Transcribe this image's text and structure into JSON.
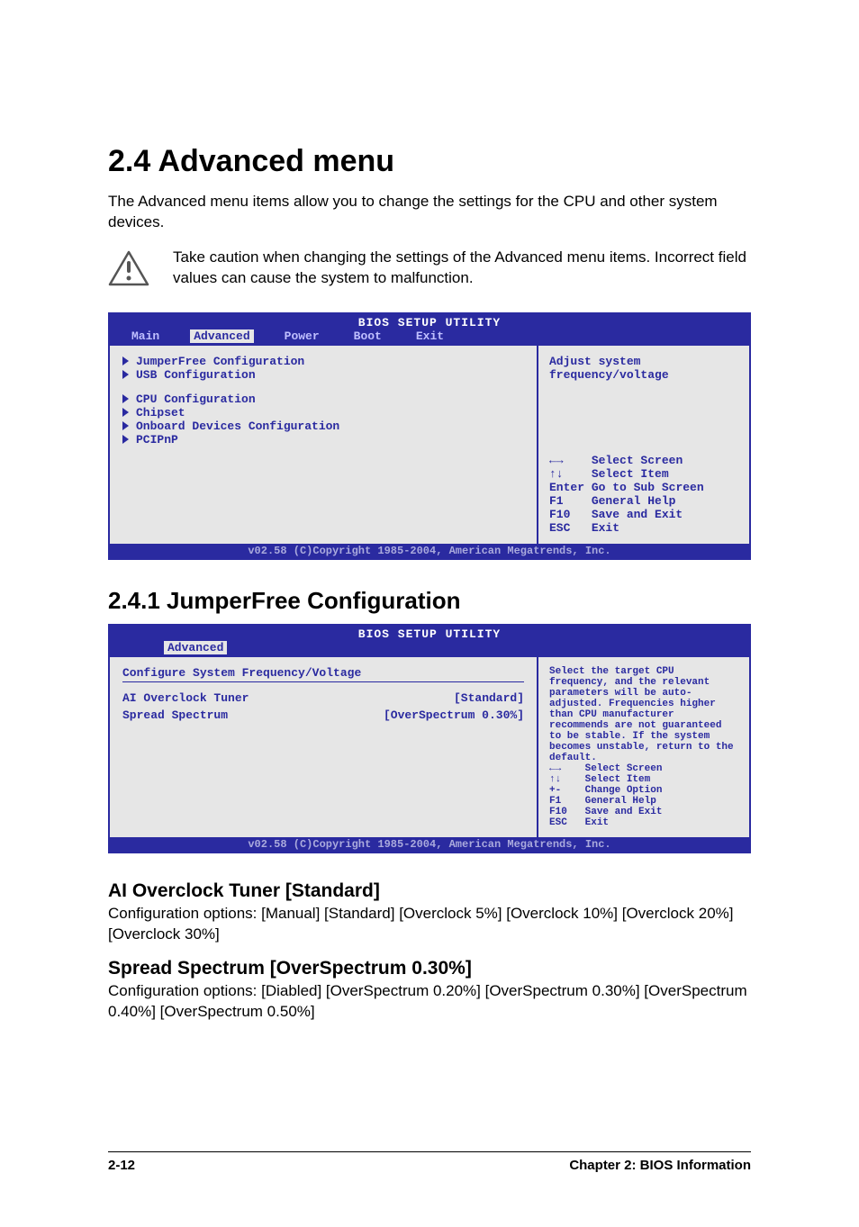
{
  "section": {
    "number": "2.4",
    "title": "Advanced menu",
    "full_title": "2.4   Advanced menu",
    "intro": "The Advanced menu items allow you to change the settings for the CPU and other system devices."
  },
  "caution": {
    "text": "Take caution when changing the settings of the Advanced menu items. Incorrect field values can cause the system to malfunction."
  },
  "bios1": {
    "title": "BIOS SETUP UTILITY",
    "tabs": [
      "Main",
      "Advanced",
      "Power",
      "Boot",
      "Exit"
    ],
    "selected_tab_index": 1,
    "group1": [
      "JumperFree Configuration",
      "USB Configuration"
    ],
    "group2": [
      "CPU Configuration",
      "Chipset",
      "Onboard Devices Configuration",
      "PCIPnP"
    ],
    "help_top": "Adjust system frequency/voltage",
    "keys": [
      {
        "k": "←→",
        "d": "Select Screen"
      },
      {
        "k": "↑↓",
        "d": "Select Item"
      },
      {
        "k": "Enter",
        "d": "Go to Sub Screen"
      },
      {
        "k": "F1",
        "d": "General Help"
      },
      {
        "k": "F10",
        "d": "Save and Exit"
      },
      {
        "k": "ESC",
        "d": "Exit"
      }
    ],
    "footer": "v02.58 (C)Copyright 1985-2004, American Megatrends, Inc."
  },
  "subsection": {
    "title": "2.4.1 JumperFree Configuration"
  },
  "bios2": {
    "title": "BIOS SETUP UTILITY",
    "tabs": [
      "Advanced"
    ],
    "selected_tab_index": 0,
    "config_header": "Configure System Frequency/Voltage",
    "rows": [
      {
        "label": "AI Overclock Tuner",
        "value": "[Standard]"
      },
      {
        "label": "Spread Spectrum",
        "value": "[OverSpectrum 0.30%]"
      }
    ],
    "help_top": "Select the target CPU frequency, and the relevant parameters will be auto-adjusted. Frequencies higher than CPU manufacturer recommends are not guaranteed to be stable. If the system becomes unstable, return to the default.",
    "keys": [
      {
        "k": "←→",
        "d": "Select Screen"
      },
      {
        "k": "↑↓",
        "d": "Select Item"
      },
      {
        "k": "+-",
        "d": "Change Option"
      },
      {
        "k": "F1",
        "d": "General Help"
      },
      {
        "k": "F10",
        "d": "Save and Exit"
      },
      {
        "k": "ESC",
        "d": "Exit"
      }
    ],
    "footer": "v02.58 (C)Copyright 1985-2004, American Megatrends, Inc."
  },
  "option1": {
    "heading": "AI Overclock Tuner [Standard]",
    "body": "Configuration options: [Manual] [Standard] [Overclock 5%] [Overclock 10%] [Overclock 20%] [Overclock 30%]"
  },
  "option2": {
    "heading": "Spread Spectrum [OverSpectrum 0.30%]",
    "body": "Configuration options: [Diabled] [OverSpectrum 0.20%] [OverSpectrum 0.30%] [OverSpectrum 0.40%] [OverSpectrum 0.50%]"
  },
  "footer": {
    "left": "2-12",
    "right": "Chapter 2: BIOS Information"
  }
}
